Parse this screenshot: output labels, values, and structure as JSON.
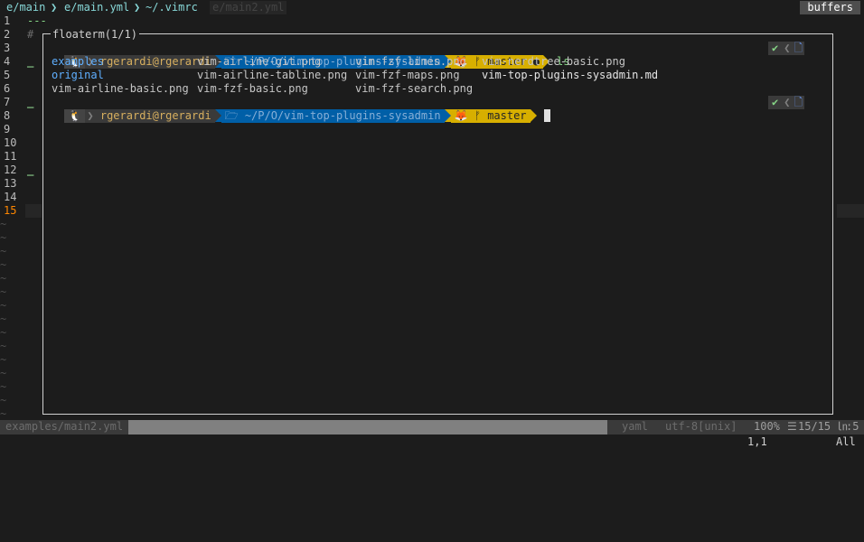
{
  "tabline": {
    "tabs": [
      "e/main",
      "e/main.yml",
      "~/.vimrc",
      "e/main2.yml"
    ],
    "buffers_label": "buffers"
  },
  "editor": {
    "line1": "---",
    "line2_comment": "#",
    "line_numbers": [
      "1",
      "2",
      "3",
      "4",
      "5",
      "6",
      "7",
      "8",
      "9",
      "10",
      "11",
      "12",
      "13",
      "14",
      "15"
    ],
    "current_line": "15",
    "tilde": "~"
  },
  "floaterm": {
    "title": "floaterm(1/1)",
    "prompt": {
      "os_icon": "🐧",
      "user": "rgerardi@rgerardi",
      "folder_icon": "🗁",
      "dir": "~/P/O/vim-top-plugins-sysadmin",
      "git_icon": "🦊",
      "branch_icon": "ᚠ",
      "branch": "master",
      "dirty_icon": "●",
      "ok_icon": "✔",
      "right_icon": "🗋"
    },
    "command": "ls",
    "ls_output": {
      "col1": [
        "examples",
        "original",
        "vim-airline-basic.png"
      ],
      "col2": [
        "vim-airline-git.png",
        "vim-airline-tabline.png",
        "vim-fzf-basic.png"
      ],
      "col3": [
        "vim-fzf-lines.png",
        "vim-fzf-maps.png",
        "vim-fzf-search.png"
      ],
      "col4": [
        "vim-nerdtree-basic.png",
        "vim-top-plugins-sysadmin.md"
      ]
    }
  },
  "statusline": {
    "file": "examples/main2.yml",
    "filetype": "yaml",
    "encoding": "utf-8[unix]",
    "percent": "100%",
    "lines_icon": "☰",
    "lines": "15/15",
    "col_icon": "㏑",
    "col": ":5"
  },
  "cmdline": {
    "position": "1,1",
    "scroll": "All"
  }
}
